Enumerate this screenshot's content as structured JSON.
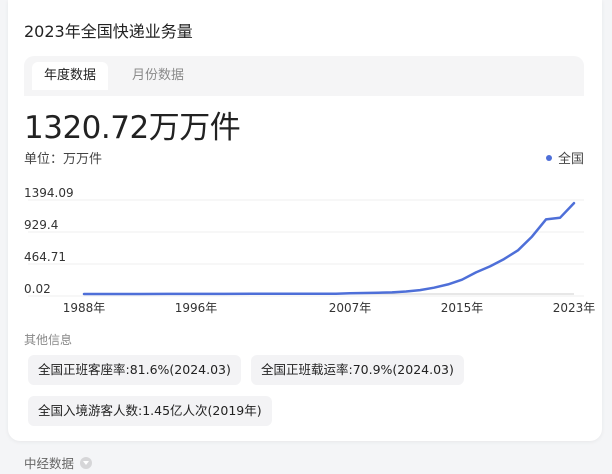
{
  "card": {
    "title": "2023年全国快递业务量"
  },
  "tabs": [
    {
      "label": "年度数据",
      "active": true
    },
    {
      "label": "月份数据",
      "active": false
    }
  ],
  "headline": {
    "value": "1320.72万万件"
  },
  "unit_label": "单位：万万件",
  "legend_label": "全国",
  "other_info": {
    "title": "其他信息",
    "chips": [
      "全国正班客座率:81.6%(2024.03)",
      "全国正班载运率:70.9%(2024.03)",
      "全国入境游客人数:1.45亿人次(2019年)"
    ]
  },
  "footer": {
    "label": "中经数据",
    "icon": "chevron-down-icon"
  },
  "colors": {
    "series": "#4e6fd8"
  },
  "chart_data": {
    "type": "line",
    "title": "",
    "y_ticks": [
      "1394.09",
      "929.4",
      "464.71",
      "0.02"
    ],
    "x_ticks": [
      "1988年",
      "1996年",
      "2007年",
      "2015年",
      "2023年"
    ],
    "ylim": [
      0.02,
      1394.09
    ],
    "series": [
      {
        "name": "全国",
        "x": [
          1988,
          1990,
          1992,
          1994,
          1996,
          1998,
          2000,
          2002,
          2004,
          2005,
          2006,
          2007,
          2008,
          2009,
          2010,
          2011,
          2012,
          2013,
          2014,
          2015,
          2016,
          2017,
          2018,
          2019,
          2020,
          2021,
          2022,
          2023
        ],
        "y": [
          0.2,
          0.3,
          0.5,
          1,
          1.5,
          2,
          2.5,
          3,
          3,
          3.5,
          5,
          12,
          15,
          19,
          23,
          37,
          57,
          92,
          140,
          207,
          313,
          401,
          507,
          635,
          833,
          1083,
          1106,
          1320.72
        ]
      }
    ],
    "grid": true
  }
}
